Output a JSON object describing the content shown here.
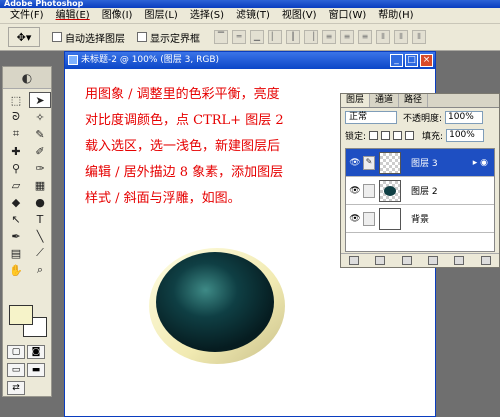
{
  "app": {
    "title": "Adobe Photoshop"
  },
  "menu": [
    "文件(F)",
    "编辑(E)",
    "图像(I)",
    "图层(L)",
    "选择(S)",
    "滤镜(T)",
    "视图(V)",
    "窗口(W)",
    "帮助(H)"
  ],
  "options": {
    "move_icon": "move-tool-icon",
    "auto_select_label": "自动选择图层",
    "show_bounds_label": "显示定界框"
  },
  "document": {
    "title": "未标题-2 @ 100% (图层 3, RGB)",
    "instructions": [
      "用图象 / 调整里的色彩平衡，亮度",
      "对比度调颜色，点 CTRL+ 图层 2",
      "载入选区，选一浅色，新建图层后",
      "编辑 / 居外描边 8 象素，添加图层",
      "样式 / 斜面与浮雕，如图。"
    ]
  },
  "layers_panel": {
    "tabs": [
      "图层",
      "通道",
      "路径"
    ],
    "blend_mode": "正常",
    "opacity_label": "不透明度:",
    "opacity": "100%",
    "lock_label": "锁定:",
    "fill_label": "填充:",
    "fill": "100%",
    "layers": [
      {
        "name": "图层 3",
        "selected": true
      },
      {
        "name": "图层 2",
        "selected": false
      },
      {
        "name": "背景",
        "selected": false
      }
    ]
  },
  "colors": {
    "foreground": "#f6f3c9",
    "background": "#ffffff",
    "instruction_text": "#e60000"
  }
}
